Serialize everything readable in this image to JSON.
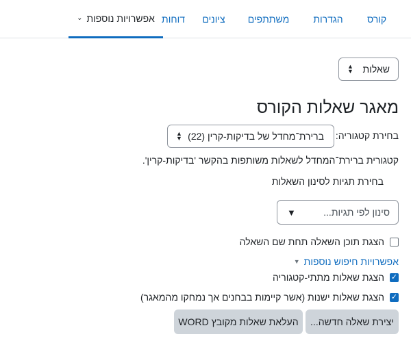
{
  "tabs": [
    {
      "label": "קורס"
    },
    {
      "label": "הגדרות"
    },
    {
      "label": "משתתפים"
    },
    {
      "label": "ציונים"
    },
    {
      "label": "דוחות"
    },
    {
      "label": "אפשרויות נוספות",
      "active": true
    }
  ],
  "page_select": {
    "value": "שאלות"
  },
  "page_title": "מאגר שאלות הקורס",
  "category": {
    "label": "בחירת קטגוריה:",
    "value": "ברירת־מחדל של בדיקות-קרין (22)",
    "description": "קטגורית ברירת־המחדל לשאלות משותפות בהקשר 'בדיקות-קרין'."
  },
  "tags": {
    "label": "בחירת תגיות לסינון השאלות",
    "placeholder": "סינון לפי תגיות...",
    "dropdown_glyph": "▼"
  },
  "show_text_checkbox": {
    "label": "הצגת תוכן השאלה תחת שם השאלה",
    "checked": false
  },
  "more_search_options": {
    "label": "אפשרויות חיפוש נוספות"
  },
  "subcategories_checkbox": {
    "label": "הצגת שאלות מתתי-קטגוריה",
    "checked": true
  },
  "old_questions_checkbox": {
    "label": "הצגת שאלות ישנות (אשר קיימות בבחנים אך נמחקו מהמאגר)",
    "checked": true
  },
  "buttons": {
    "create_new": "יצירת שאלה חדשה...",
    "import_word": "העלאת שאלות מקובץ WORD"
  }
}
